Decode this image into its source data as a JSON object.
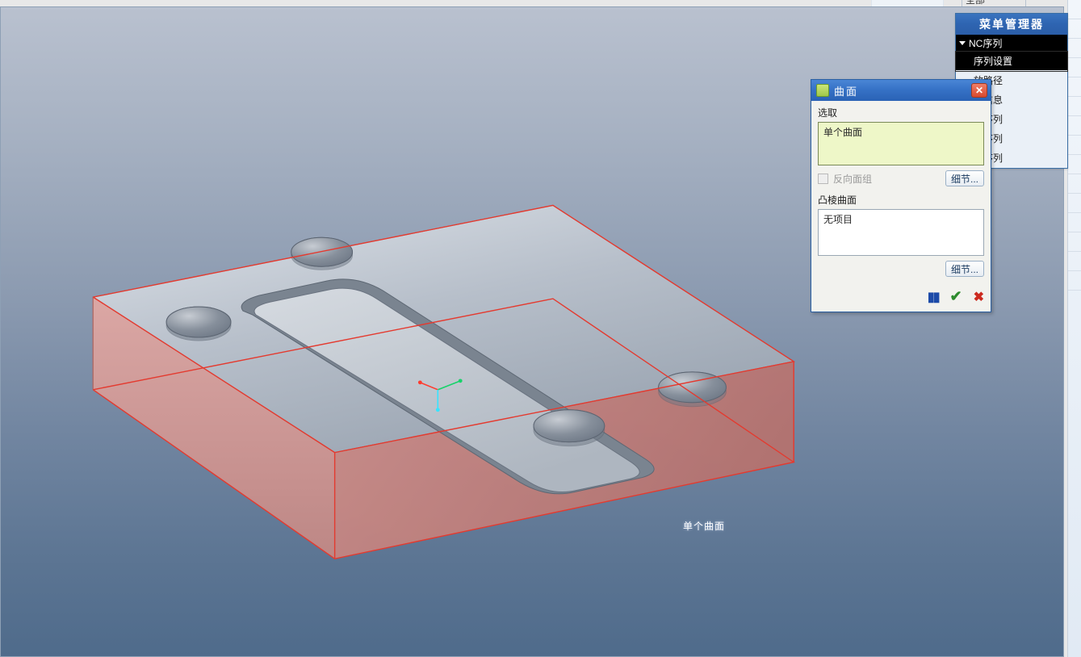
{
  "top": {
    "combo_text": "全部"
  },
  "viewport": {
    "floating_label": "单个曲面"
  },
  "menu_manager": {
    "title": "菜单管理器",
    "section_label": "NC序列",
    "items": [
      {
        "label": "序列设置",
        "selected": true
      },
      {
        "label": "放路径",
        "selected": false
      },
      {
        "label": "列信息",
        "selected": false
      },
      {
        "label": "成序列",
        "selected": false
      },
      {
        "label": "一序列",
        "selected": false
      },
      {
        "label": "弃序列",
        "selected": false
      }
    ]
  },
  "surface_dialog": {
    "title": "曲面",
    "select_label": "选取",
    "select_list_item": "单个曲面",
    "reverse_group_label": "反向面组",
    "details_button": "细节...",
    "ridge_label": "凸棱曲面",
    "ridge_list_item": "无项目"
  }
}
